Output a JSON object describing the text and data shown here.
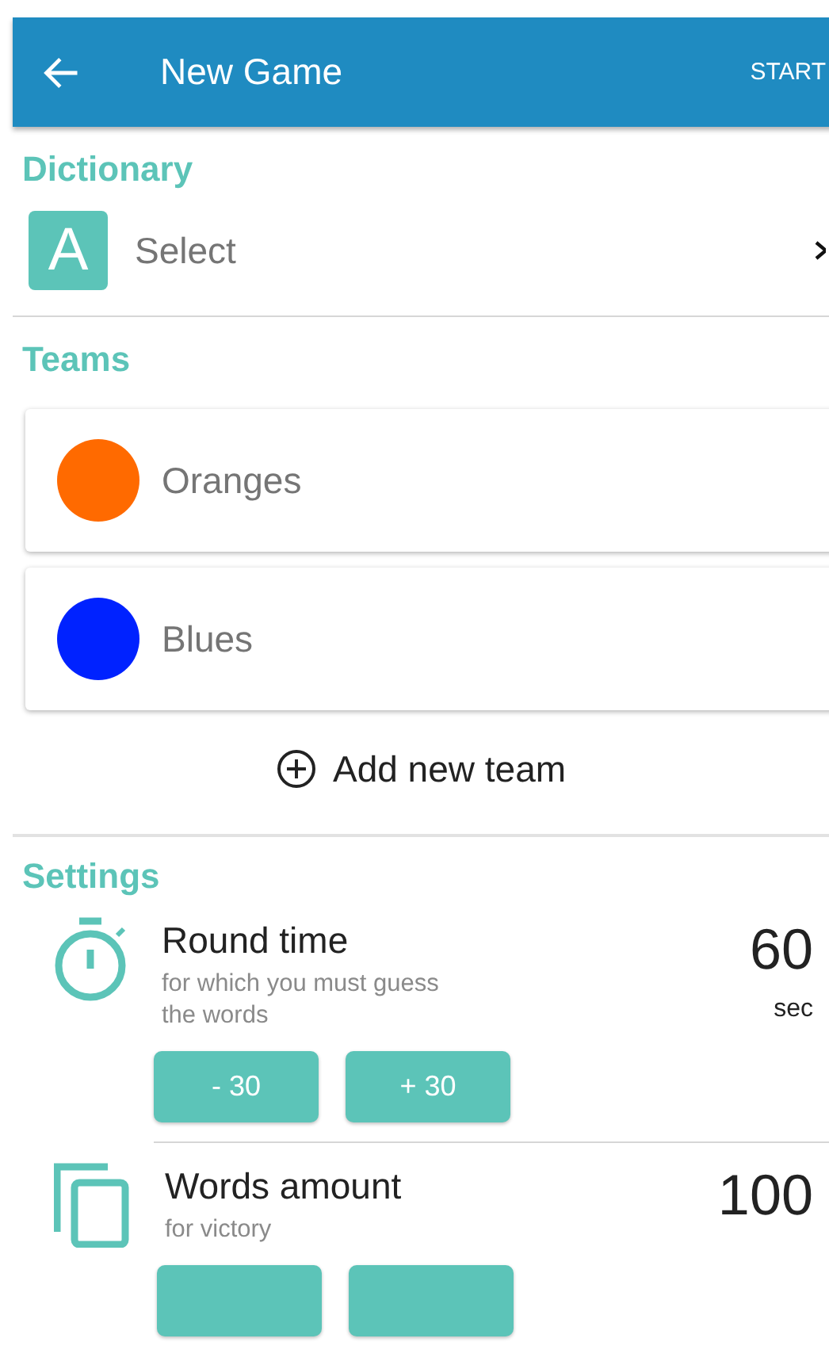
{
  "app_bar": {
    "title": "New Game",
    "action": "START"
  },
  "dictionary": {
    "heading": "Dictionary",
    "icon_letter": "A",
    "placeholder": "Select"
  },
  "teams": {
    "heading": "Teams",
    "items": [
      {
        "name": "Oranges",
        "color": "#ff6a00"
      },
      {
        "name": "Blues",
        "color": "#0022ff"
      }
    ],
    "add_label": "Add new team"
  },
  "settings": {
    "heading": "Settings",
    "items": [
      {
        "kind": "timer",
        "title": "Round time",
        "subtitle": "for which you must guess the words",
        "value": "60",
        "unit": "sec",
        "buttons": [
          {
            "kind": "step",
            "label": "- 30"
          },
          {
            "kind": "step",
            "label": "+ 30"
          }
        ]
      },
      {
        "kind": "cards",
        "title": "Words amount",
        "subtitle": "for victory",
        "value": "100",
        "buttons": [
          {
            "kind": "step"
          },
          {
            "kind": "step"
          }
        ]
      }
    ]
  }
}
